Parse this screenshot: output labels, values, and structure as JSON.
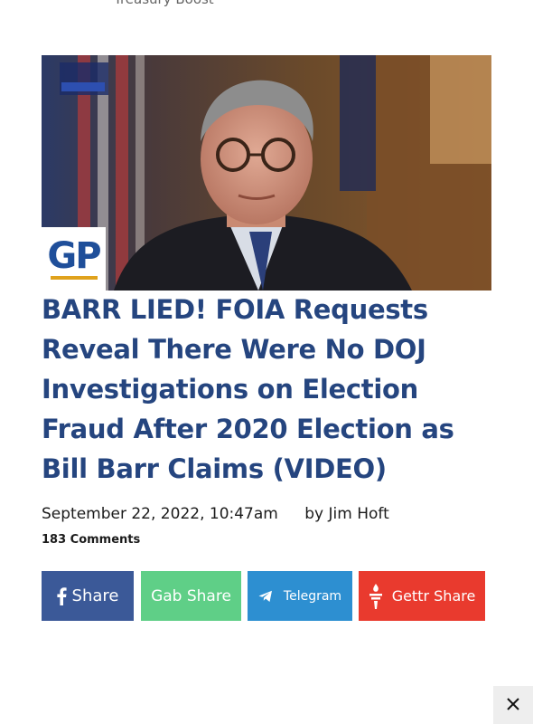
{
  "page": {
    "top_cut_text": "Treasury Boost"
  },
  "hero": {
    "image_alt": "Bill Barr interview",
    "badge_text": "GP"
  },
  "article": {
    "headline": "BARR LIED! FOIA Requests Reveal There Were No DOJ Investigations on Election Fraud After 2020 Election as Bill Barr Claims (VIDEO)",
    "date": "September 22, 2022, 10:47am",
    "author": "by Jim Hoft",
    "comments": "183 Comments"
  },
  "share": {
    "facebook_label": "Share",
    "gab_label": "Gab Share",
    "telegram_label": "Telegram",
    "gettr_label": "Gettr Share"
  },
  "overlay": {
    "close_label": "X"
  },
  "colors": {
    "headline": "#25457f",
    "facebook": "#3b5998",
    "gab": "#5fcf87",
    "telegram": "#2d8fd1",
    "gettr": "#e93a2e",
    "gp_blue": "#1f4f9a",
    "gp_gold": "#e0a21c"
  }
}
